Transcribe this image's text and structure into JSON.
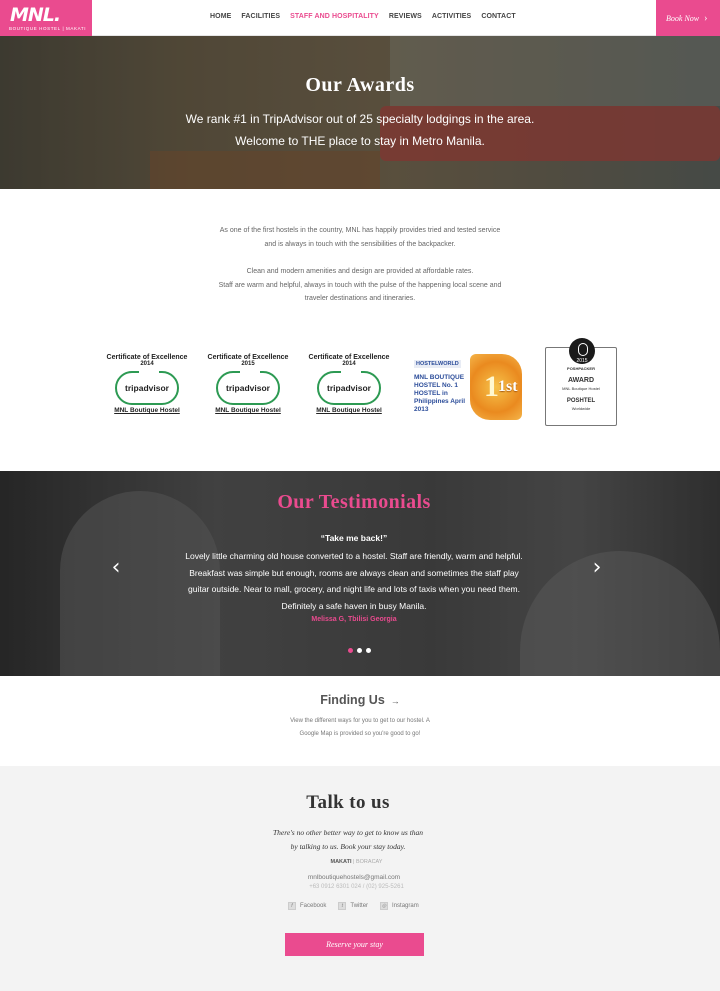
{
  "nav": {
    "logo_mark": "MNL.",
    "logo_sub": "BOUTIQUE HOSTEL | MAKATI",
    "items": [
      {
        "label": "HOME",
        "active": false
      },
      {
        "label": "FACILITIES",
        "active": false
      },
      {
        "label": "STAFF AND HOSPITALITY",
        "active": true
      },
      {
        "label": "REVIEWS",
        "active": false
      },
      {
        "label": "ACTIVITIES",
        "active": false
      },
      {
        "label": "CONTACT",
        "active": false
      }
    ],
    "book_label": "Book Now",
    "accent_color": "#ea4b8f"
  },
  "hero": {
    "title": "Our Awards",
    "line1": "We rank #1 in TripAdvisor out of 25 specialty lodgings in the area.",
    "line2": "Welcome to THE place to stay in Metro Manila."
  },
  "intro": {
    "p1_l1": "As one of the first hostels in the country, MNL has happily provides tried and tested service",
    "p1_l2": "and is always in touch with the sensibilities of the backpacker.",
    "p2_l1": "Clean and modern amenities and design are provided at affordable rates.",
    "p2_l2": "Staff are warm and helpful, always in touch with the pulse of the happening local scene and",
    "p2_l3": "traveler destinations and itineraries."
  },
  "awards": {
    "certs": [
      {
        "title": "Certificate of Excellence",
        "year": "2014",
        "brand": "tripadvisor",
        "name": "MNL Boutique Hostel"
      },
      {
        "title": "Certificate of Excellence",
        "year": "2015",
        "brand": "tripadvisor",
        "name": "MNL Boutique Hostel"
      },
      {
        "title": "Certificate of Excellence",
        "year": "2014",
        "brand": "tripadvisor",
        "name": "MNL Boutique Hostel"
      }
    ],
    "hostelworld": {
      "head": "HOSTELWORLD",
      "text": "MNL BOUTIQUE HOSTEL No. 1 HOSTEL in Philippines April 2013",
      "rank": "1st"
    },
    "posh": {
      "year": "2015",
      "brand": "POSHPACKER",
      "award": "AWARD",
      "sub": "MNL Boutique Hostel",
      "category": "POSHTEL",
      "scope": "Worldwide"
    }
  },
  "testimonials": {
    "title": "Our Testimonials",
    "quote_title": "“Take me back!”",
    "quote_l1": "Lovely little charming old house converted to a hostel. Staff are friendly, warm and helpful.",
    "quote_l2": "Breakfast was simple but enough, rooms are always clean and sometimes the staff play",
    "quote_l3": "guitar outside. Near to mall, grocery, and night life and lots of taxis when you need them.",
    "quote_l4": "Definitely a safe haven in busy Manila.",
    "author": "Melissa G, Tbilisi Georgia",
    "prev_icon": "‹",
    "next_icon": "›",
    "slides": 3,
    "active_slide": 1
  },
  "finding": {
    "title": "Finding Us",
    "arrow": "→",
    "l1": "View the different ways for you to get to our hostel. A",
    "l2": "Google Map is provided so you're good to go!"
  },
  "talk": {
    "title": "Talk to us",
    "lead_l1": "There's no other better way to get to know us than",
    "lead_l2": "by talking to us. Book your stay today.",
    "loc_active": "MAKATI",
    "loc_sep": " | ",
    "loc_other": "BORACAY",
    "email": "mnlboutiquehostels@gmail.com",
    "phone": "+63 0912 6301 024 / (02) 925-5261",
    "social": [
      "Facebook",
      "Twitter",
      "Instagram"
    ],
    "reserve_label": "Reserve your stay"
  }
}
